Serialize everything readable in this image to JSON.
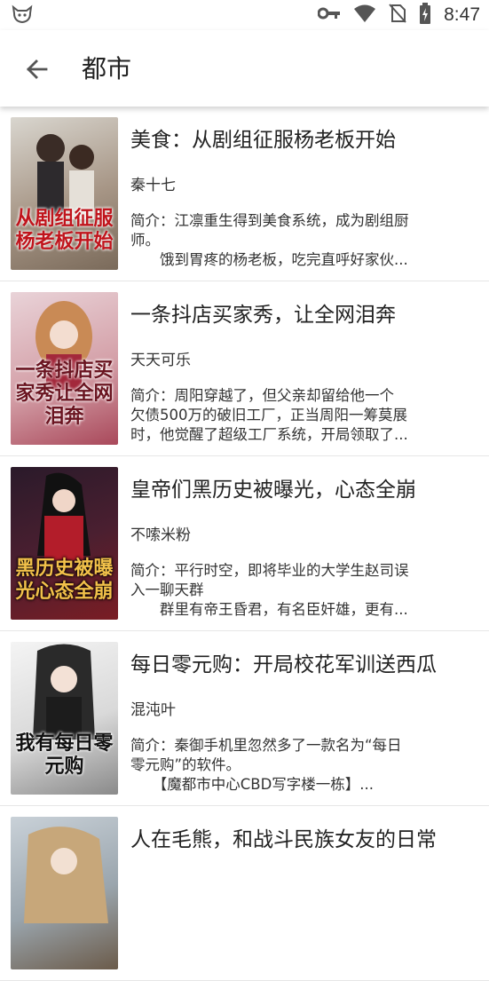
{
  "status": {
    "time": "8:47"
  },
  "header": {
    "title": "都市"
  },
  "books": [
    {
      "title": "美食：从剧组征服杨老板开始",
      "author": "秦十七",
      "desc_lines": [
        "简介：江凛重生得到美食系统，成为剧组厨",
        "师。",
        "　　饿到胃疼的杨老板，吃完直呼好家伙..."
      ],
      "cover_text": "从剧组征服杨老板开始",
      "cover_colors": [
        "#d9d6cf",
        "#7a6a5a"
      ]
    },
    {
      "title": "一条抖店买家秀，让全网泪奔",
      "author": "天天可乐",
      "desc_lines": [
        "简介：周阳穿越了，但父亲却留给他一个",
        "欠债500万的破旧工厂，正当周阳一筹莫展",
        "时，他觉醒了超级工厂系统，开局领取了..."
      ],
      "cover_text": "一条抖店买家秀让全网泪奔",
      "cover_colors": [
        "#e9d3d8",
        "#a9485a"
      ]
    },
    {
      "title": "皇帝们黑历史被曝光，心态全崩",
      "author": "不嗦米粉",
      "desc_lines": [
        "简介：平行时空，即将毕业的大学生赵司误",
        "入一聊天群",
        "　　群里有帝王昏君，有名臣奸雄，更有..."
      ],
      "cover_text": "黑历史被曝光心态全崩",
      "cover_colors": [
        "#2a1a2a",
        "#7a1d24"
      ]
    },
    {
      "title": "每日零元购：开局校花军训送西瓜",
      "author": "混沌叶",
      "desc_lines": [
        "简介：秦御手机里忽然多了一款名为“每日",
        "零元购”的软件。",
        "　　【魔都市中心CBD写字楼一栋】..."
      ],
      "cover_text": "我有每日零元购",
      "cover_colors": [
        "#ececec",
        "#2a2a2a"
      ]
    },
    {
      "title": "人在毛熊，和战斗民族女友的日常",
      "author": "",
      "desc_lines": [],
      "cover_text": "",
      "cover_colors": [
        "#b8c2cc",
        "#6b5b4a"
      ]
    }
  ]
}
